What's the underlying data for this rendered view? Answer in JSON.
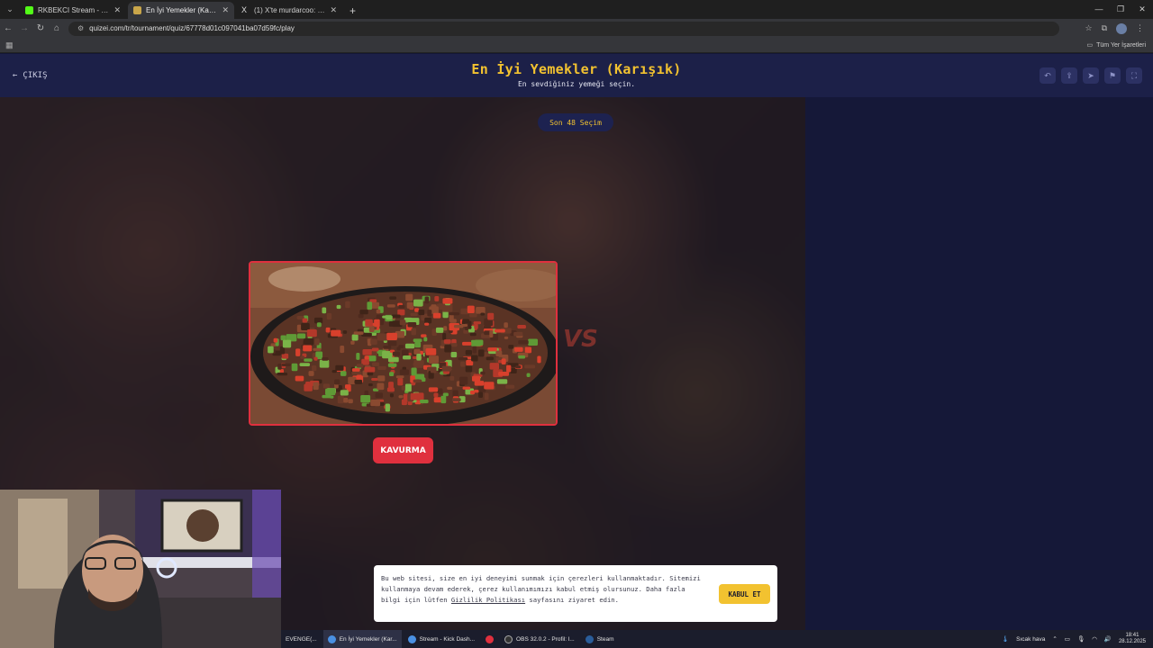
{
  "browser": {
    "tabs": [
      {
        "title": "RKBEKCI Stream - Watch Live o",
        "color": "#53fc18",
        "active": false
      },
      {
        "title": "En İyi Yemekler (Karışık) - Tier L",
        "color": "#c9a64a",
        "active": true
      },
      {
        "title": "(1) X'te murdarcoo: \"23/24de su",
        "color": "#dddddd",
        "active": false
      }
    ],
    "url": "quizei.com/tr/tournament/quiz/67778d01c097041ba07d59fc/play",
    "bookmarks_all": "Tüm Yer İşaretleri"
  },
  "header": {
    "exit_label": "ÇIKIŞ",
    "title": "En İyi Yemekler (Karışık)",
    "subtitle": "En sevdiğiniz yemeği seçin."
  },
  "round": {
    "label": "Son 48 Seçim"
  },
  "card": {
    "choice_label": "KAVURMA",
    "vs_text": "VS"
  },
  "cookie": {
    "text_before": "Bu web sitesi, size en iyi deneyimi sunmak için çerezleri kullanmaktadır. Sitemizi kullanmaya devam ederek, çerez kullanımımızı kabul etmiş olursunuz. Daha fazla bilgi için lütfen ",
    "link": "Gizlilik Politikası",
    "text_after": " sayfasını ziyaret edin.",
    "accept": "KABUL ET"
  },
  "taskbar": {
    "items": [
      {
        "label": "EVENGE(...",
        "color": "#888888",
        "active": false
      },
      {
        "label": "En İyi Yemekler (Kar...",
        "color": "#4a90e2",
        "active": true
      },
      {
        "label": "Stream - Kick Dash...",
        "color": "#4a90e2",
        "active": false
      },
      {
        "label": "",
        "color": "#e0303e",
        "active": false
      },
      {
        "label": "OBS 32.0.2 - Profil: l...",
        "color": "#333333",
        "active": false
      },
      {
        "label": "Steam",
        "color": "#2a5d9a",
        "active": false
      }
    ],
    "weather": "Sıcak hava",
    "time": "18:41",
    "date": "28.12.2025"
  }
}
